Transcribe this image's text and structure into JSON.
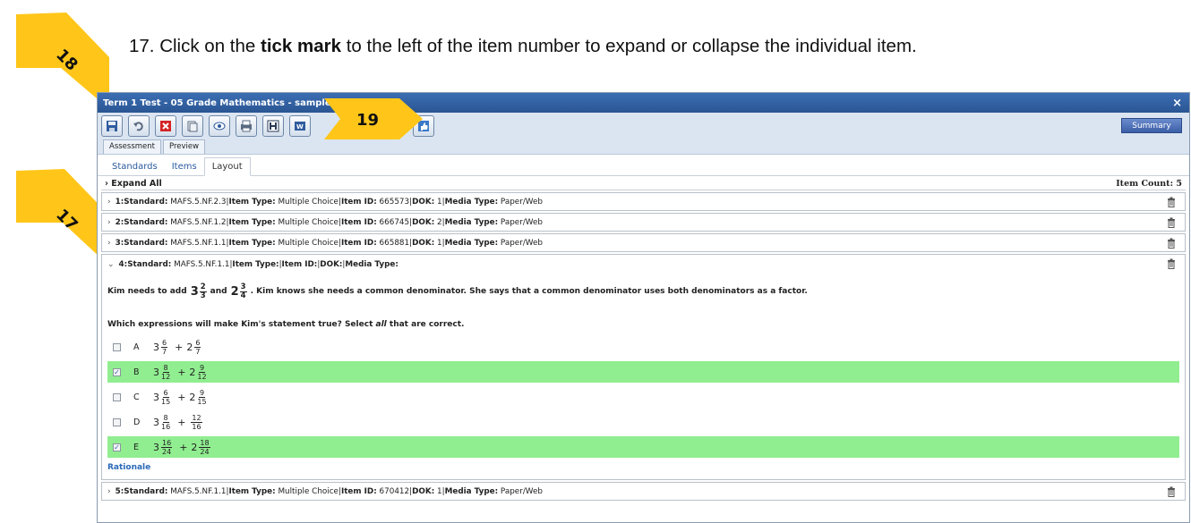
{
  "instruction": {
    "prefix": "17.  Click on the ",
    "bold": "tick mark",
    "suffix": " to the left of the item number to expand or collapse the individual item."
  },
  "callouts": [
    {
      "label": "18",
      "color": "#ffc619"
    },
    {
      "label": "19",
      "color": "#ffc619"
    },
    {
      "label": "17",
      "color": "#ffc619"
    }
  ],
  "window": {
    "title": "Term 1 Test - 05 Grade Mathematics - sampleclassroomtest",
    "close": "×",
    "summary_label": "Summary",
    "toolbar_icons": [
      "save-icon",
      "undo-icon",
      "delete-icon",
      "copy-icon",
      "preview-icon",
      "print-icon",
      "h-icon",
      "word-icon",
      "thumbs-up-icon"
    ],
    "mode_tabs": [
      "Assessment",
      "Preview"
    ],
    "sub_tabs": [
      "Standards",
      "Items",
      "Layout"
    ],
    "active_sub_tab": "Layout",
    "expand_all": "Expand All",
    "item_count": "Item Count: 5"
  },
  "items": [
    {
      "num": "1",
      "standard": "MAFS.5.NF.2.3",
      "item_type": "Multiple Choice",
      "item_id": "665573",
      "dok": "1",
      "media": "Paper/Web"
    },
    {
      "num": "2",
      "standard": "MAFS.5.NF.1.2",
      "item_type": "Multiple Choice",
      "item_id": "666745",
      "dok": "2",
      "media": "Paper/Web"
    },
    {
      "num": "3",
      "standard": "MAFS.5.NF.1.1",
      "item_type": "Multiple Choice",
      "item_id": "665881",
      "dok": "1",
      "media": "Paper/Web"
    },
    {
      "num": "4",
      "standard": "MAFS.5.NF.1.1",
      "item_type": "",
      "item_id": "",
      "dok": "",
      "media": ""
    },
    {
      "num": "5",
      "standard": "MAFS.5.NF.1.1",
      "item_type": "Multiple Choice",
      "item_id": "670412",
      "dok": "1",
      "media": "Paper/Web"
    }
  ],
  "labels": {
    "standard": "Standard:",
    "item_type": "Item Type:",
    "item_id": "Item ID:",
    "dok": "DOK:",
    "media": "Media Type:",
    "sep": " | ",
    "colon": " : "
  },
  "expanded": {
    "q_part1": "Kim needs to add",
    "mixed1": {
      "whole": "3",
      "num": "2",
      "den": "3"
    },
    "q_and": "and",
    "mixed2": {
      "whole": "2",
      "num": "3",
      "den": "4"
    },
    "q_part2": ". Kim knows she needs a common denominator.  She says that a common denominator uses both denominators as a factor.",
    "question_a": "Which expressions will make Kim's statement true?  Select ",
    "question_all": "all",
    "question_b": " that are correct.",
    "choices": [
      {
        "letter": "A",
        "w1": "3",
        "n1": "6",
        "d1": "7",
        "w2": "2",
        "n2": "6",
        "d2": "7",
        "checked": false,
        "correct": false
      },
      {
        "letter": "B",
        "w1": "3",
        "n1": "8",
        "d1": "12",
        "w2": "2",
        "n2": "9",
        "d2": "12",
        "checked": true,
        "correct": true
      },
      {
        "letter": "C",
        "w1": "3",
        "n1": "6",
        "d1": "15",
        "w2": "2",
        "n2": "9",
        "d2": "15",
        "checked": false,
        "correct": false
      },
      {
        "letter": "D",
        "w1": "3",
        "n1": "8",
        "d1": "16",
        "w2": "",
        "n2": "12",
        "d2": "16",
        "checked": false,
        "correct": false
      },
      {
        "letter": "E",
        "w1": "3",
        "n1": "16",
        "d1": "24",
        "w2": "2",
        "n2": "18",
        "d2": "24",
        "checked": true,
        "correct": true
      }
    ],
    "plus": "+",
    "check": "✓",
    "rationale": "Rationale"
  }
}
